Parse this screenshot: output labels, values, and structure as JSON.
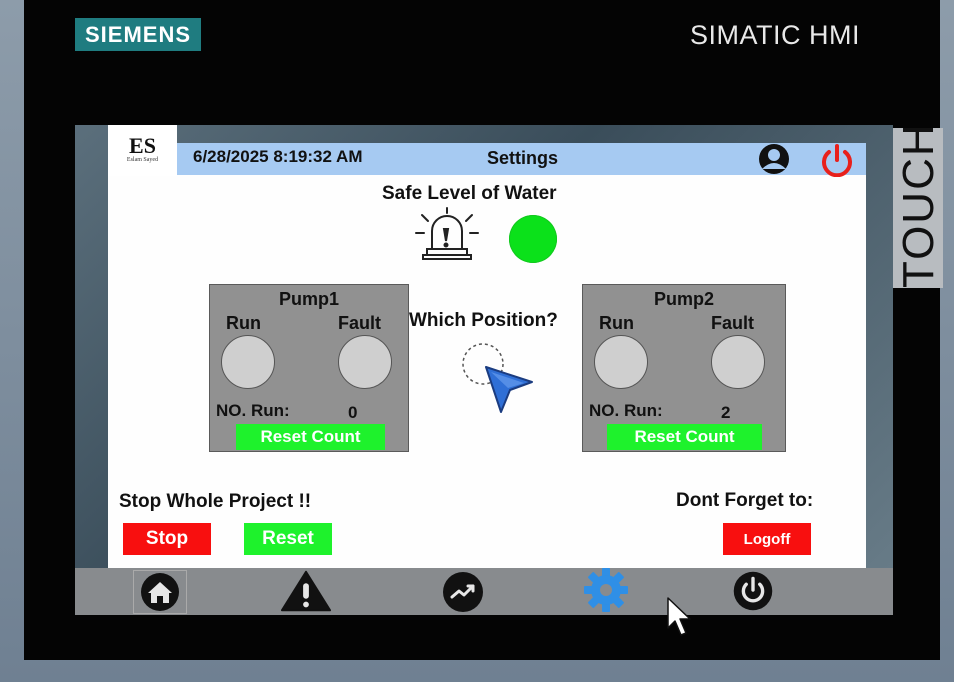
{
  "device": {
    "brand": "SIEMENS",
    "model": "SIMATIC HMI",
    "side_label": "TOUCH"
  },
  "header": {
    "logo_text": "ES",
    "logo_subtext": "Eslam Sayed",
    "datetime": "6/28/2025 8:19:32 AM",
    "title": "Settings",
    "user_icon": "user-icon",
    "power_icon": "power-icon"
  },
  "water": {
    "label": "Safe Level of Water",
    "alarm_icon": "siren-icon",
    "status_color": "#0be11a"
  },
  "position": {
    "label": "Which Position?",
    "icon": "pointer-position-icon"
  },
  "pumps": [
    {
      "title": "Pump1",
      "run_label": "Run",
      "fault_label": "Fault",
      "count_label": "NO. Run:",
      "count": "0",
      "reset_label": "Reset Count"
    },
    {
      "title": "Pump2",
      "run_label": "Run",
      "fault_label": "Fault",
      "count_label": "NO. Run:",
      "count": "2",
      "reset_label": "Reset Count"
    }
  ],
  "controls": {
    "stop_heading": "Stop Whole Project !!",
    "stop_label": "Stop",
    "reset_label": "Reset",
    "logoff_heading": "Dont Forget to:",
    "logoff_label": "Logoff"
  },
  "nav": [
    {
      "name": "home",
      "icon": "home-icon"
    },
    {
      "name": "alarms",
      "icon": "warning-icon"
    },
    {
      "name": "trends",
      "icon": "trend-icon"
    },
    {
      "name": "settings",
      "icon": "gear-icon"
    },
    {
      "name": "shutdown",
      "icon": "power-icon"
    }
  ],
  "colors": {
    "header_bar": "#a6caf2",
    "ok_green": "#1ef22c",
    "stop_red": "#f80f0f",
    "panel_gray": "#919191",
    "siemens_teal": "#1f7c80",
    "nav_active": "#2f8fe6"
  }
}
